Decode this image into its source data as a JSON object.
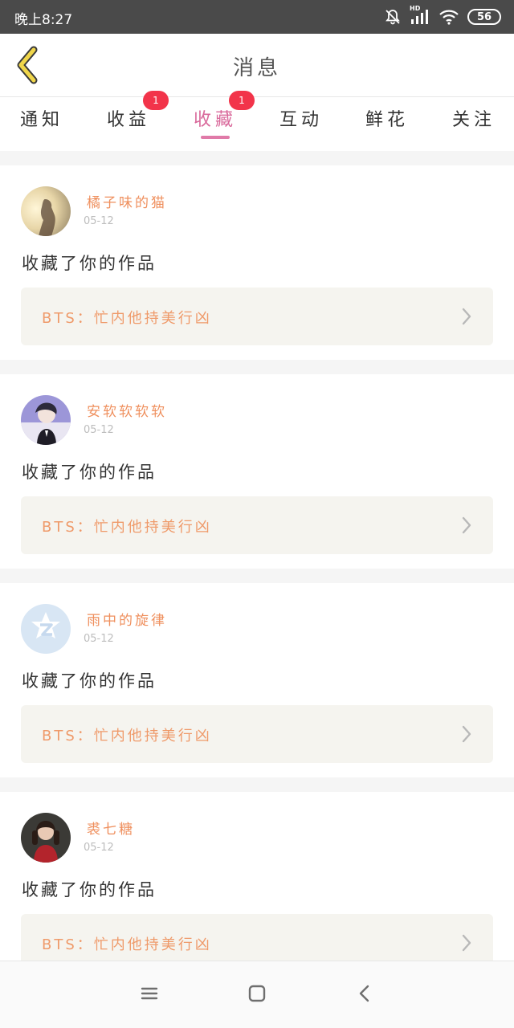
{
  "status_bar": {
    "time": "晚上8:27",
    "network_label": "HD",
    "battery": "56",
    "icons": [
      "mute-icon",
      "signal-icon",
      "wifi-icon",
      "battery-icon"
    ]
  },
  "header": {
    "title": "消息",
    "back_icon": "chevron-left-icon",
    "accent": "#e0c531"
  },
  "tabs": [
    {
      "label": "通知",
      "badge": "",
      "active": false
    },
    {
      "label": "收益",
      "badge": "1",
      "active": false
    },
    {
      "label": "收藏",
      "badge": "1",
      "active": true
    },
    {
      "label": "互动",
      "badge": "",
      "active": false
    },
    {
      "label": "鲜花",
      "badge": "",
      "active": false
    },
    {
      "label": "关注",
      "badge": "",
      "active": false
    }
  ],
  "colors": {
    "active_tab": "#d9699b",
    "badge": "#f2344a",
    "username": "#ef8f5d",
    "work_title": "#ef9a6a",
    "work_bg": "#f5f4ef"
  },
  "notifications": [
    {
      "username": "橘子味的猫",
      "date": "05-12",
      "message": "收藏了你的作品",
      "work_title": "BTS：忙内他持美行凶",
      "avatar": "photo-avatar-sunset"
    },
    {
      "username": "安软软软软",
      "date": "05-12",
      "message": "收藏了你的作品",
      "work_title": "BTS：忙内他持美行凶",
      "avatar": "photo-avatar-person"
    },
    {
      "username": "雨中的旋律",
      "date": "05-12",
      "message": "收藏了你的作品",
      "work_title": "BTS：忙内他持美行凶",
      "avatar": "default-qq-avatar"
    },
    {
      "username": "裘七糖",
      "date": "05-12",
      "message": "收藏了你的作品",
      "work_title": "BTS：忙内他持美行凶",
      "avatar": "photo-avatar-girl"
    }
  ],
  "nav_bar": {
    "buttons": [
      "menu-icon",
      "home-icon",
      "back-icon"
    ]
  }
}
